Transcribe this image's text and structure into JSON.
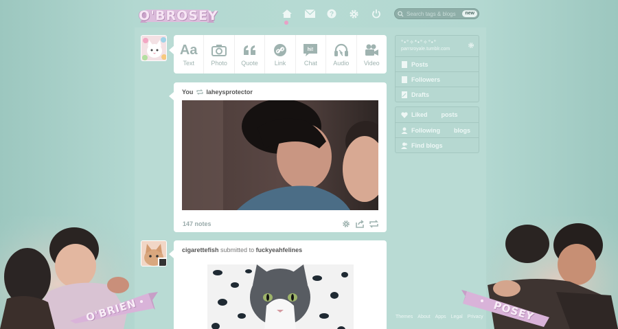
{
  "header": {
    "logo": "O'BROSEY",
    "nav": [
      "home-icon",
      "mail-icon",
      "help-icon",
      "gear-icon",
      "power-icon"
    ],
    "search_placeholder": "Search tags & blogs",
    "search_badge": "new"
  },
  "post_types": [
    {
      "label": "Text",
      "icon": "text-icon"
    },
    {
      "label": "Photo",
      "icon": "camera-icon"
    },
    {
      "label": "Quote",
      "icon": "quote-icon"
    },
    {
      "label": "Link",
      "icon": "link-icon"
    },
    {
      "label": "Chat",
      "icon": "chat-icon"
    },
    {
      "label": "Audio",
      "icon": "headphones-icon"
    },
    {
      "label": "Video",
      "icon": "video-icon"
    }
  ],
  "posts": [
    {
      "author": "You",
      "reblogged_from": "laheysprotector",
      "notes": "147 notes"
    },
    {
      "author": "cigarettefish",
      "connector": "submitted to",
      "target": "fuckyeahfelines"
    }
  ],
  "sidebar": {
    "blog_name": "°•°✧*•°✧°•°",
    "blog_url": "parrsroyale.tumblr.com",
    "blog_items": [
      "Posts",
      "Followers",
      "Drafts"
    ],
    "liked_label": "Liked",
    "liked_suffix": "posts",
    "following_label": "Following",
    "following_suffix": "blogs",
    "find_label": "Find blogs"
  },
  "footer": [
    "Themes",
    "About",
    "Apps",
    "Legal",
    "Privacy"
  ],
  "ribbons": {
    "left": "O'BRIEN",
    "right": "POSEY"
  },
  "colors": {
    "background": "#a8d0c9",
    "ribbon": "#d9b3d9",
    "accent_pink": "#e8a1c6"
  }
}
